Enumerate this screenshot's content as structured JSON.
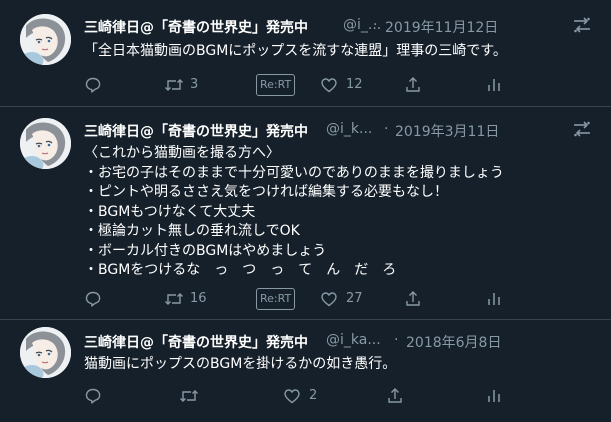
{
  "tweets": [
    {
      "name": "三崎律日@「奇書の世界史」発売中",
      "handle": "@i_...",
      "dot": "·",
      "date": "2019年11月12日",
      "text": "「全日本猫動画のBGMにポップスを流すな連盟」理事の三崎です。",
      "reply_count": "",
      "retweet_count": "3",
      "rert_label": "Re:RT",
      "like_count": "12"
    },
    {
      "name": "三崎律日@「奇書の世界史」発売中",
      "handle": "@i_k...",
      "dot": "·",
      "date": "2019年3月11日",
      "text": "〈これから猫動画を撮る方へ〉\n・お宅の子はそのままで十分可愛いのでありのままを撮りましょう\n・ピントや明るささえ気をつければ編集する必要もなし！\n・BGMもつけなくて大丈夫\n・極論カット無しの垂れ流しでOK\n・ボーカル付きのBGMはやめましょう\n・BGMをつけるな　っ　つ　っ　て　ん　だ　ろ",
      "reply_count": "",
      "retweet_count": "16",
      "rert_label": "Re:RT",
      "like_count": "27"
    },
    {
      "name": "三崎律日@「奇書の世界史」発売中",
      "handle": "@i_ka...",
      "dot": "·",
      "date": "2018年6月8日",
      "text": "猫動画にポップスのBGMを掛けるかの如き愚行。",
      "reply_count": "",
      "retweet_count": "",
      "like_count": "2"
    }
  ],
  "icons": {
    "reply": "reply-icon",
    "retweet": "retweet-icon",
    "like": "heart-icon",
    "share": "share-icon",
    "analytics": "analytics-icon",
    "menu": "menu-icon"
  },
  "colors": {
    "background": "#15202b",
    "text": "#ffffff",
    "secondary": "#8899a6",
    "divider": "#38444d"
  }
}
